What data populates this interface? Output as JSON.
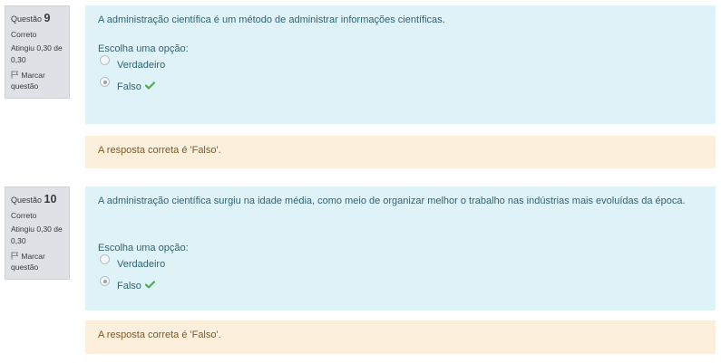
{
  "questions": [
    {
      "number_label": "Questão",
      "number": "9",
      "state": "Correto",
      "grade": "Atingiu 0,30 de 0,30",
      "flag_label": "Marcar questão",
      "text": "A administração científica é um método de administrar informações científicas.",
      "prompt": "Escolha uma opção:",
      "options": [
        {
          "label": "Verdadeiro",
          "checked": false
        },
        {
          "label": "Falso",
          "checked": true,
          "correct_mark": true
        }
      ],
      "feedback": "A resposta correta é 'Falso'."
    },
    {
      "number_label": "Questão",
      "number": "10",
      "state": "Correto",
      "grade": "Atingiu 0,30 de 0,30",
      "flag_label": "Marcar questão",
      "text": "A administração científica surgiu na idade média, como meio de organizar melhor o trabalho nas indústrias mais evoluídas da época.",
      "prompt": "Escolha uma opção:",
      "options": [
        {
          "label": "Verdadeiro",
          "checked": false
        },
        {
          "label": "Falso",
          "checked": true,
          "correct_mark": true
        }
      ],
      "feedback": "A resposta correta é 'Falso'."
    }
  ],
  "colors": {
    "info_bg": "#dee2e6",
    "formulation_bg": "#def2f8",
    "formulation_text": "#2f6473",
    "feedback_bg": "#fcefdc",
    "feedback_text": "#7d5a29",
    "correct_check": "#4caf50"
  },
  "icons": {
    "flag": "flag-icon",
    "correct": "check-icon"
  }
}
